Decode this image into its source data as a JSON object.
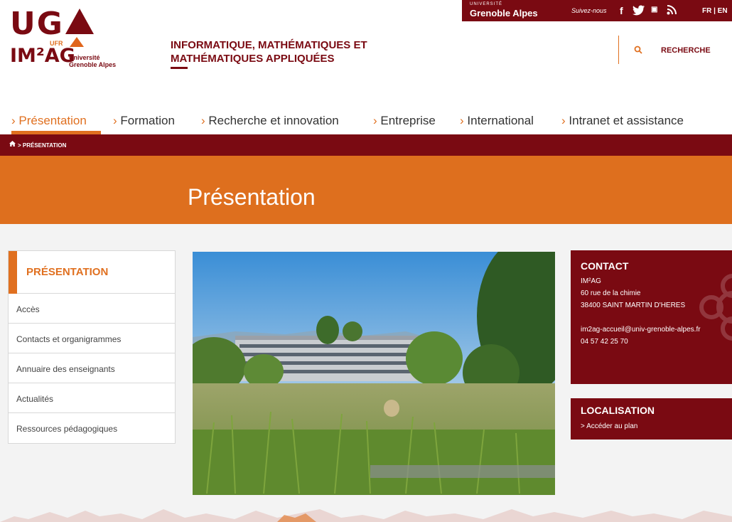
{
  "header": {
    "logo_uga": "UG",
    "logo_ufr": "UFR",
    "logo_imag": "IM²AG",
    "logo_sub_line1": "Université",
    "logo_sub_line2": "Grenoble Alpes",
    "ufr_title_line1": "INFORMATIQUE, MATHÉMATIQUES ET",
    "ufr_title_line2": "MATHÉMATIQUES APPLIQUÉES",
    "uga_badge_small": "UNIVERSITÉ",
    "uga_badge_big": "Grenoble Alpes",
    "follow_label": "Suivez-nous",
    "social_icons": [
      "facebook-icon",
      "twitter-icon",
      "youtube-icon",
      "rss-icon"
    ],
    "lang_label": "FR | EN",
    "search_label": "RECHERCHE"
  },
  "nav": {
    "items": [
      {
        "label": "Présentation",
        "active": true
      },
      {
        "label": "Formation",
        "active": false
      },
      {
        "label": "Recherche et innovation",
        "active": false
      },
      {
        "label": "Entreprise",
        "active": false
      },
      {
        "label": "International",
        "active": false
      },
      {
        "label": "Intranet et assistance",
        "active": false
      }
    ]
  },
  "breadcrumb": {
    "label": "> PRÉSENTATION"
  },
  "banner": {
    "title": "Présentation"
  },
  "sidebar": {
    "heading": "PRÉSENTATION",
    "items": [
      {
        "label": "Accès"
      },
      {
        "label": "Contacts et organigrammes"
      },
      {
        "label": "Annuaire des enseignants"
      },
      {
        "label": "Actualités"
      },
      {
        "label": "Ressources pédagogiques"
      }
    ]
  },
  "contact": {
    "heading": "CONTACT",
    "org": "IM²AG",
    "address1": "60 rue de la chimie",
    "address2": "38400 SAINT MARTIN D'HERES",
    "email": "im2ag-accueil@univ-grenoble-alpes.fr",
    "phone": "04 57 42 25 70"
  },
  "localisation": {
    "heading": "LOCALISATION",
    "link": "> Accéder au plan"
  },
  "colors": {
    "primary": "#7a0a12",
    "accent": "#e07020",
    "banner": "#de6f1e"
  }
}
